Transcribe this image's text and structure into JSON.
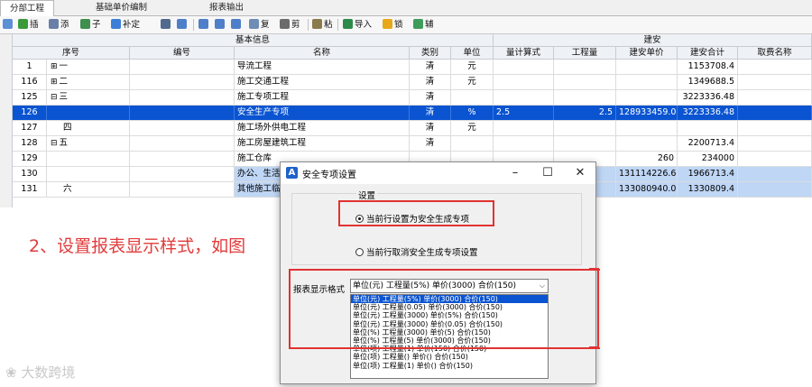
{
  "tabs": [
    "分部工程",
    "基础单价编制",
    "报表输出"
  ],
  "toolbar": {
    "insert": "插",
    "add": "添",
    "child": "子",
    "fill": "补定",
    "cut": "剪",
    "copy": "复",
    "paste": "粘",
    "import": "导入",
    "lock": "锁",
    "aux": "辅"
  },
  "table": {
    "group_basic": "基本信息",
    "group_build": "建安",
    "headers": {
      "seq": "序号",
      "code": "编号",
      "name": "名称",
      "cat": "类别",
      "unit": "单位",
      "qexp": "量计算式",
      "qty": "工程量",
      "price": "建安单价",
      "total": "建安合计",
      "fee": "取费名称"
    },
    "rows": [
      {
        "id": "1",
        "seq": "一",
        "name": "导流工程",
        "cat": "清",
        "unit": "元",
        "qexp": "",
        "qty": "",
        "price": "",
        "total": "1153708.4"
      },
      {
        "id": "116",
        "seq": "二",
        "name": "施工交通工程",
        "cat": "清",
        "unit": "元",
        "qexp": "",
        "qty": "",
        "price": "",
        "total": "1349688.5"
      },
      {
        "id": "125",
        "seq": "三",
        "name": "施工专项工程",
        "cat": "清",
        "unit": "",
        "qexp": "",
        "qty": "",
        "price": "",
        "total": "3223336.48"
      },
      {
        "id": "126",
        "seq": "",
        "name": "安全生产专项",
        "cat": "清",
        "unit": "%",
        "qexp": "2.5",
        "qty": "2.5",
        "price": "128933459.05",
        "total": "3223336.48"
      },
      {
        "id": "127",
        "seq": "四",
        "name": "施工场外供电工程",
        "cat": "清",
        "unit": "元",
        "qexp": "",
        "qty": "",
        "price": "",
        "total": ""
      },
      {
        "id": "128",
        "seq": "五",
        "name": "施工房屋建筑工程",
        "cat": "清",
        "unit": "",
        "qexp": "",
        "qty": "",
        "price": "",
        "total": "2200713.4"
      },
      {
        "id": "129",
        "seq": "",
        "name": "施工仓库",
        "cat": "",
        "unit": "",
        "qexp": "",
        "qty": "",
        "price": "260",
        "total": "234000"
      },
      {
        "id": "130",
        "seq": "",
        "name": "办公、生活",
        "cat": "",
        "unit": "",
        "qexp": "",
        "qty": "",
        "price": "131114226.63",
        "total": "1966713.4"
      },
      {
        "id": "131",
        "seq": "六",
        "name": "其他施工临",
        "cat": "",
        "unit": "",
        "qexp": "",
        "qty": "",
        "price": "133080940.03",
        "total": "1330809.4"
      }
    ]
  },
  "annotation": "2、设置报表显示样式，如图",
  "watermark": "大数跨境",
  "dialog": {
    "title": "安全专项设置",
    "group_label": "设置",
    "radio_set": "当前行设置为安全生成专项",
    "radio_cancel": "当前行取消安全生成专项设置",
    "format_label": "报表显示格式",
    "format_value": "单位(元) 工程量(5%) 单价(3000) 合价(150)",
    "options": [
      "单位(元) 工程量(5%) 单价(3000) 合价(150)",
      "单位(元) 工程量(0.05) 单价(3000) 合价(150)",
      "单位(元) 工程量(3000) 单价(5%) 合价(150)",
      "单位(元) 工程量(3000) 单价(0.05) 合价(150)",
      "单位(%) 工程量(3000) 单价(5) 合价(150)",
      "单位(%) 工程量(5) 单价(3000) 合价(150)",
      "单位(项) 工程量(1) 单价(150) 合价(150)",
      "单位(项) 工程量() 单价() 合价(150)",
      "单位(项) 工程量(1) 单价() 合价(150)"
    ]
  },
  "colors": {
    "selection": "#0a54d1",
    "annotation": "#e33b3b",
    "highlight_row": "#bfd6f5"
  }
}
